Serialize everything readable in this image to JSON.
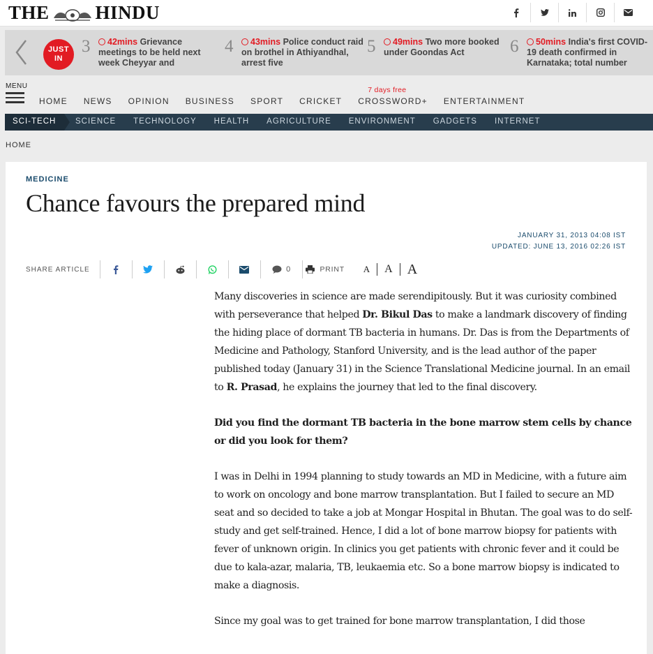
{
  "header": {
    "logo_left": "THE",
    "logo_right": "HINDU",
    "social": [
      "f",
      "t",
      "in",
      "ig",
      "mail"
    ]
  },
  "just_in": {
    "badge_line1": "JUST",
    "badge_line2": "IN",
    "items": [
      {
        "num": "3",
        "mins": "42mins",
        "text": "Grievance meetings to be held next week Cheyyar and"
      },
      {
        "num": "4",
        "mins": "43mins",
        "text": "Police conduct raid on brothel in Athiyandhal, arrest five"
      },
      {
        "num": "5",
        "mins": "49mins",
        "text": "Two more booked under Goondas Act"
      },
      {
        "num": "6",
        "mins": "50mins",
        "text": "India's first COVID-19 death confirmed in Karnataka; total number"
      }
    ]
  },
  "nav": {
    "menu_label": "MENU",
    "crossword_note": "7 days free",
    "items": [
      "HOME",
      "NEWS",
      "OPINION",
      "BUSINESS",
      "SPORT",
      "CRICKET",
      "CROSSWORD+",
      "ENTERTAINMENT"
    ]
  },
  "subnav": {
    "active": "SCI-TECH",
    "items": [
      "SCIENCE",
      "TECHNOLOGY",
      "HEALTH",
      "AGRICULTURE",
      "ENVIRONMENT",
      "GADGETS",
      "INTERNET"
    ]
  },
  "breadcrumb": "HOME",
  "article": {
    "kicker": "MEDICINE",
    "headline": "Chance favours the prepared mind",
    "published": "JANUARY 31, 2013 04:08 IST",
    "updated": "UPDATED: JUNE 13, 2016 02:26 IST",
    "share_label": "SHARE ARTICLE",
    "comment_count": "0",
    "print_label": "PRINT",
    "font_small": "A",
    "font_medium": "A",
    "font_large": "A",
    "p1_a": "Many discoveries in science are made serendipitously. But it was curiosity combined with perseverance that helped ",
    "p1_name1": "Dr. Bikul Das",
    "p1_b": " to make a landmark discovery of finding the hiding place of dormant TB bacteria in humans. Dr. Das is from the Departments of Medicine and Pathology, Stanford University, and is the lead author of the paper published today (January 31) in the Science Translational Medicine journal. In an email to ",
    "p1_name2": "R. Prasad",
    "p1_c": ", he explains the journey that led to the final discovery.",
    "question": "Did you find the dormant TB bacteria in the bone marrow stem cells by chance or did you look for them?",
    "p2": "I was in Delhi in 1994 planning to study towards an MD in Medicine, with a future aim to work on oncology and bone marrow transplantation. But I failed to secure an MD seat and so decided to take a job at Mongar Hospital in Bhutan. The goal was to do self-study and get self-trained. Hence, I did a lot of bone marrow biopsy for patients with fever of unknown origin. In clinics you get patients with chronic fever and it could be due to kala-azar, malaria, TB, leukaemia etc. So a bone marrow biopsy is indicated to make a diagnosis.",
    "p3": "Since my goal was to get trained for bone marrow transplantation, I did those"
  }
}
